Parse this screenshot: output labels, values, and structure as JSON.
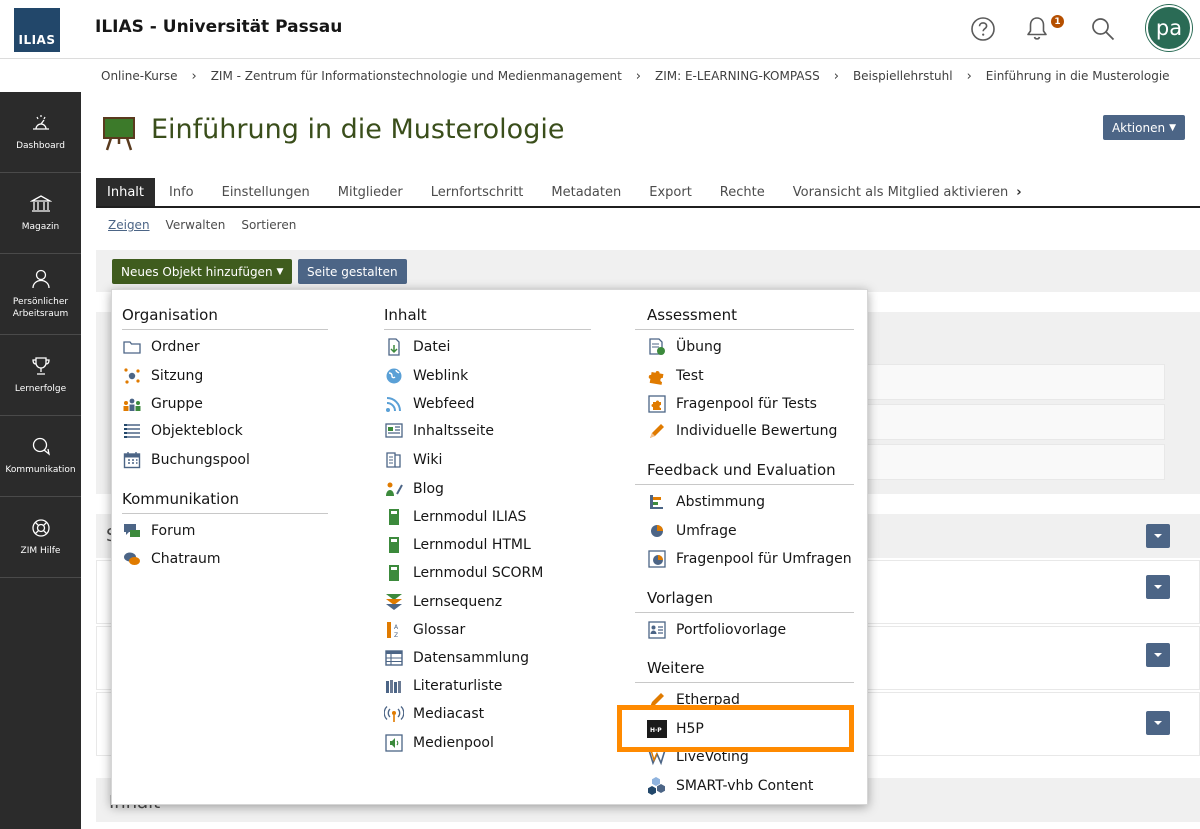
{
  "header": {
    "logo_text": "ILIAS",
    "app_title": "ILIAS - Universität Passau",
    "notification_count": "1",
    "avatar_initials": "pa"
  },
  "breadcrumb": [
    "Online-Kurse",
    "ZIM - Zentrum für Informationstechnologie und Medienmanagement",
    "ZIM: E-LEARNING-KOMPASS",
    "Beispiellehrstuhl",
    "Einführung in die Musterologie"
  ],
  "sidebar": {
    "items": [
      {
        "label": "Dashboard",
        "icon": "dashboard-icon"
      },
      {
        "label": "Magazin",
        "icon": "library-icon"
      },
      {
        "label": "Persönlicher Arbeitsraum",
        "icon": "person-icon"
      },
      {
        "label": "Lernerfolge",
        "icon": "trophy-icon"
      },
      {
        "label": "Kommunikation",
        "icon": "chat-icon"
      },
      {
        "label": "ZIM Hilfe",
        "icon": "lifebuoy-icon"
      }
    ]
  },
  "page": {
    "title": "Einführung in die Musterologie",
    "actions_label": "Aktionen",
    "tabs": [
      "Inhalt",
      "Info",
      "Einstellungen",
      "Mitglieder",
      "Lernfortschritt",
      "Metadaten",
      "Export",
      "Rechte",
      "Voransicht als Mitglied aktivieren"
    ],
    "active_tab": "Inhalt",
    "subtabs": [
      "Zeigen",
      "Verwalten",
      "Sortieren"
    ],
    "active_subtab": "Zeigen",
    "new_object_label": "Neues Objekt hinzufügen",
    "layout_label": "Seite gestalten",
    "bg_partial_letter": "S",
    "bg_bottom_text": "Inhalt"
  },
  "dropdown": {
    "organisation": {
      "title": "Organisation",
      "items": [
        "Ordner",
        "Sitzung",
        "Gruppe",
        "Objekteblock",
        "Buchungspool"
      ]
    },
    "kommunikation": {
      "title": "Kommunikation",
      "items": [
        "Forum",
        "Chatraum"
      ]
    },
    "inhalt": {
      "title": "Inhalt",
      "items": [
        "Datei",
        "Weblink",
        "Webfeed",
        "Inhaltsseite",
        "Wiki",
        "Blog",
        "Lernmodul ILIAS",
        "Lernmodul HTML",
        "Lernmodul SCORM",
        "Lernsequenz",
        "Glossar",
        "Datensammlung",
        "Literaturliste",
        "Mediacast",
        "Medienpool"
      ]
    },
    "assessment": {
      "title": "Assessment",
      "items": [
        "Übung",
        "Test",
        "Fragenpool für Tests",
        "Individuelle Bewertung"
      ]
    },
    "feedback": {
      "title": "Feedback und Evaluation",
      "items": [
        "Abstimmung",
        "Umfrage",
        "Fragenpool für Umfragen"
      ]
    },
    "vorlagen": {
      "title": "Vorlagen",
      "items": [
        "Portfoliovorlage"
      ]
    },
    "weitere": {
      "title": "Weitere",
      "items": [
        "Etherpad",
        "H5P",
        "LiveVoting",
        "SMART-vhb Content"
      ]
    }
  },
  "colors": {
    "accent_blue": "#4c6586",
    "accent_green": "#3f5c1e",
    "highlight_orange": "#ff8a00",
    "sidebar_bg": "#2b2b2b"
  }
}
